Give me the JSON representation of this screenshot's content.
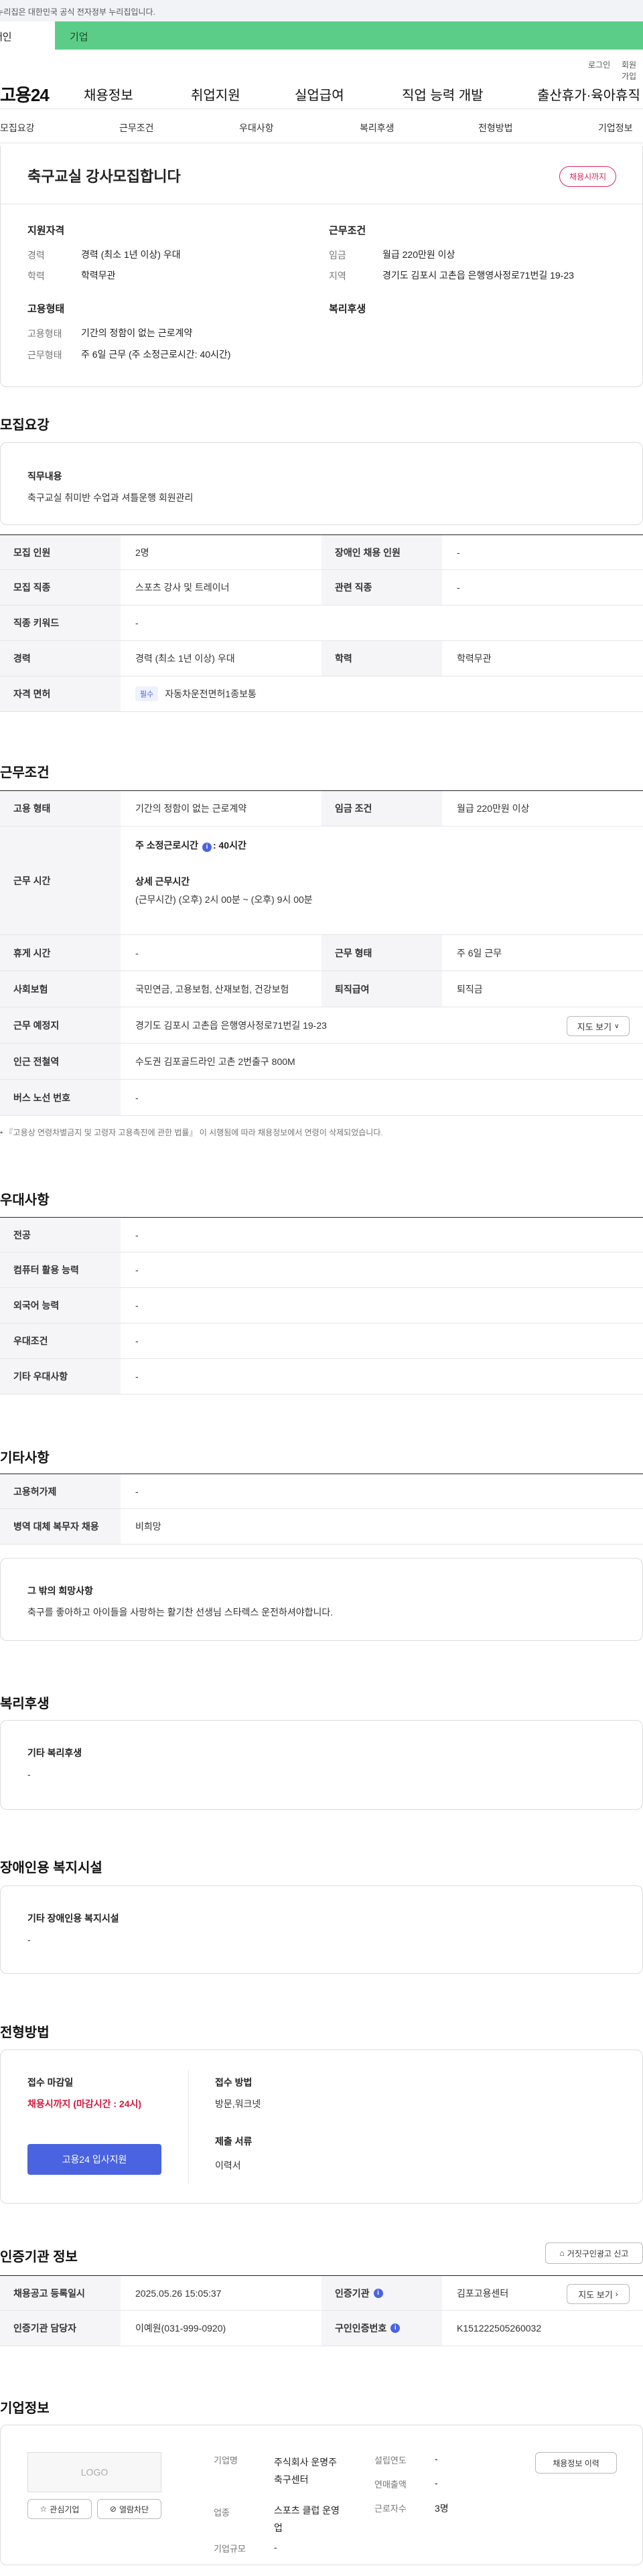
{
  "banner": "이 누리집은 대한민국 공식 전자정부 누리집입니다.",
  "tabs": {
    "personal": "개인",
    "company": "기업"
  },
  "util": {
    "login": "로그인",
    "join": "회원가입"
  },
  "gnb": {
    "logo": "고용24",
    "menu": [
      "채용정보",
      "취업지원",
      "실업급여",
      "직업 능력 개발",
      "출산휴가·육아휴직"
    ]
  },
  "anchors": [
    "모집요강",
    "근무조건",
    "우대사항",
    "복리후생",
    "전형방법",
    "기업정보"
  ],
  "summary": {
    "title": "축구교실 강사모집합니다",
    "badge": "채용시까지",
    "qual_h": "지원자격",
    "career_l": "경력",
    "career_v": "경력 (최소 1년 이상) 우대",
    "edu_l": "학력",
    "edu_v": "학력무관",
    "cond_h": "근무조건",
    "wage_l": "임금",
    "wage_v": "월급 220만원 이상",
    "region_l": "지역",
    "region_v": "경기도 김포시 고촌읍 은행영사정로71번길 19-23",
    "emp_h": "고용형태",
    "type_l": "고용형태",
    "type_v": "기간의 정함이 없는 근로계약",
    "form_l": "근무형태",
    "form_v": "주 6일 근무 (주 소정근로시간: 40시간)",
    "welfare_h": "복리후생"
  },
  "recruit": {
    "title": "모집요강",
    "duty_h": "직무내용",
    "duty_v": "축구교실 취미반 수업과 셔틀운행 회원관리",
    "count_l": "모집 인원",
    "count_v": "2명",
    "disabled_l": "장애인 채용 인원",
    "disabled_v": "-",
    "job_l": "모집 직종",
    "job_v": "스포츠 강사 및 트레이너",
    "rel_l": "관련 직종",
    "rel_v": "-",
    "kw_l": "직종 키워드",
    "kw_v": "-",
    "career_l": "경력",
    "career_v": "경력 (최소 1년 이상) 우대",
    "edu_l": "학력",
    "edu_v": "학력무관",
    "lic_l": "자격 면허",
    "lic_tag": "필수",
    "lic_v": "자동차운전면허1종보통"
  },
  "work": {
    "title": "근무조건",
    "type_l": "고용 형태",
    "type_v": "기간의 정함이 없는 근로계약",
    "wage_l": "임금 조건",
    "wage_v": "월급 220만원 이상",
    "hours_l": "근무 시간",
    "hours_v1": "주 소정근로시간",
    "hours_v1b": ": 40시간",
    "hours_h2": "상세 근무시간",
    "hours_v2": "(근무시간) (오후) 2시 00분 ~ (오후) 9시 00분",
    "rest_l": "휴게 시간",
    "rest_v": "-",
    "form_l": "근무 형태",
    "form_v": "주 6일 근무",
    "ins_l": "사회보험",
    "ins_v": "국민연금, 고용보험, 산재보험, 건강보험",
    "ret_l": "퇴직급여",
    "ret_v": "퇴직금",
    "place_l": "근무 예정지",
    "place_v": "경기도 김포시 고촌읍 은행영사정로71번길 19-23",
    "map_btn": "지도 보기",
    "sub_l": "인근 전철역",
    "sub_v": "수도권 김포골드라인 고촌 2번출구 800M",
    "bus_l": "버스 노선 번호",
    "bus_v": "-",
    "note": "『고용상 연령차별금지 및 고령자 고용촉진에 관한 법률』 이 시행됨에 따라 채용정보에서 연령이 삭제되었습니다."
  },
  "pref": {
    "title": "우대사항",
    "major_l": "전공",
    "major_v": "-",
    "pc_l": "컴퓨터 활용 능력",
    "pc_v": "-",
    "lang_l": "외국어 능력",
    "lang_v": "-",
    "cond_l": "우대조건",
    "cond_v": "-",
    "etc_l": "기타 우대사항",
    "etc_v": "-"
  },
  "other": {
    "title": "기타사항",
    "permit_l": "고용허가제",
    "permit_v": "-",
    "mil_l": "병역 대체 복무자 채용",
    "mil_v": "비희망",
    "wish_h": "그 밖의 희망사항",
    "wish_v": "축구를 좋아하고 아이들을 사랑하는 활기찬 선생님 스타렉스 운전하셔야합니다."
  },
  "welfare": {
    "title": "복리후생",
    "etc_h": "기타 복리후생",
    "etc_v": "-"
  },
  "disab": {
    "title": "장애인용 복지시설",
    "etc_h": "기타 장애인용 복지시설",
    "etc_v": "-"
  },
  "proc": {
    "title": "전형방법",
    "deadline_h": "접수 마감일",
    "deadline_v": "채용시까지 (마감시간 : 24시)",
    "apply_btn": "고용24 입사지원",
    "method_h": "접수 방법",
    "method_v": "방문,워크넷",
    "docs_h": "제출 서류",
    "docs_v": "이력서"
  },
  "cert": {
    "title": "인증기관 정보",
    "report_btn": "거짓구인광고 신고",
    "reg_l": "채용공고 등록일시",
    "reg_v": "2025.05.26 15:05:37",
    "org_l": "인증기관",
    "org_v": "김포고용센터",
    "map_btn": "지도 보기",
    "mgr_l": "인증기관 담당자",
    "mgr_v": "이예원(031-999-0920)",
    "no_l": "구인인증번호",
    "no_v": "K151222505260032"
  },
  "company": {
    "title": "기업정보",
    "logo": "LOGO",
    "fav_btn": "관심기업",
    "block_btn": "열람차단",
    "name_l": "기업명",
    "name_v": "주식회사 운명주 축구센터",
    "ind_l": "업종",
    "ind_v": "스포츠 클럽 운영업",
    "size_l": "기업규모",
    "size_v": "-",
    "est_l": "설립연도",
    "est_v": "-",
    "rev_l": "연매출액",
    "rev_v": "-",
    "emp_l": "근로자수",
    "emp_v": "3명",
    "hist_btn": "채용정보 이력"
  },
  "colors": {
    "accent_green": "#5ccd88",
    "primary_blue": "#4a63e0",
    "badge_red": "#e0245e",
    "deadline_red": "#d4183d"
  }
}
